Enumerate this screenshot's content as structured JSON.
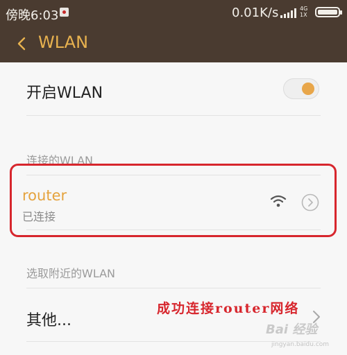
{
  "status_bar": {
    "time": "傍晚6:03",
    "speed": "0.01K/s",
    "network_type_top": "4G",
    "network_type_bottom": "1X"
  },
  "header": {
    "title": "WLAN"
  },
  "wlan_toggle": {
    "label": "开启WLAN",
    "enabled": true
  },
  "connected_section": {
    "title": "连接的WLAN",
    "network": {
      "name": "router",
      "status": "已连接"
    }
  },
  "nearby_section": {
    "title": "选取附近的WLAN",
    "other_label": "其他..."
  },
  "annotation": {
    "text": "成功连接router网络"
  },
  "watermark": {
    "brand": "Bai 经验",
    "url": "jingyan.baidu.com"
  },
  "colors": {
    "bar": "#4a3b30",
    "accent": "#e8b24f",
    "highlight": "#d7262d",
    "router_text": "#e5a33e"
  }
}
